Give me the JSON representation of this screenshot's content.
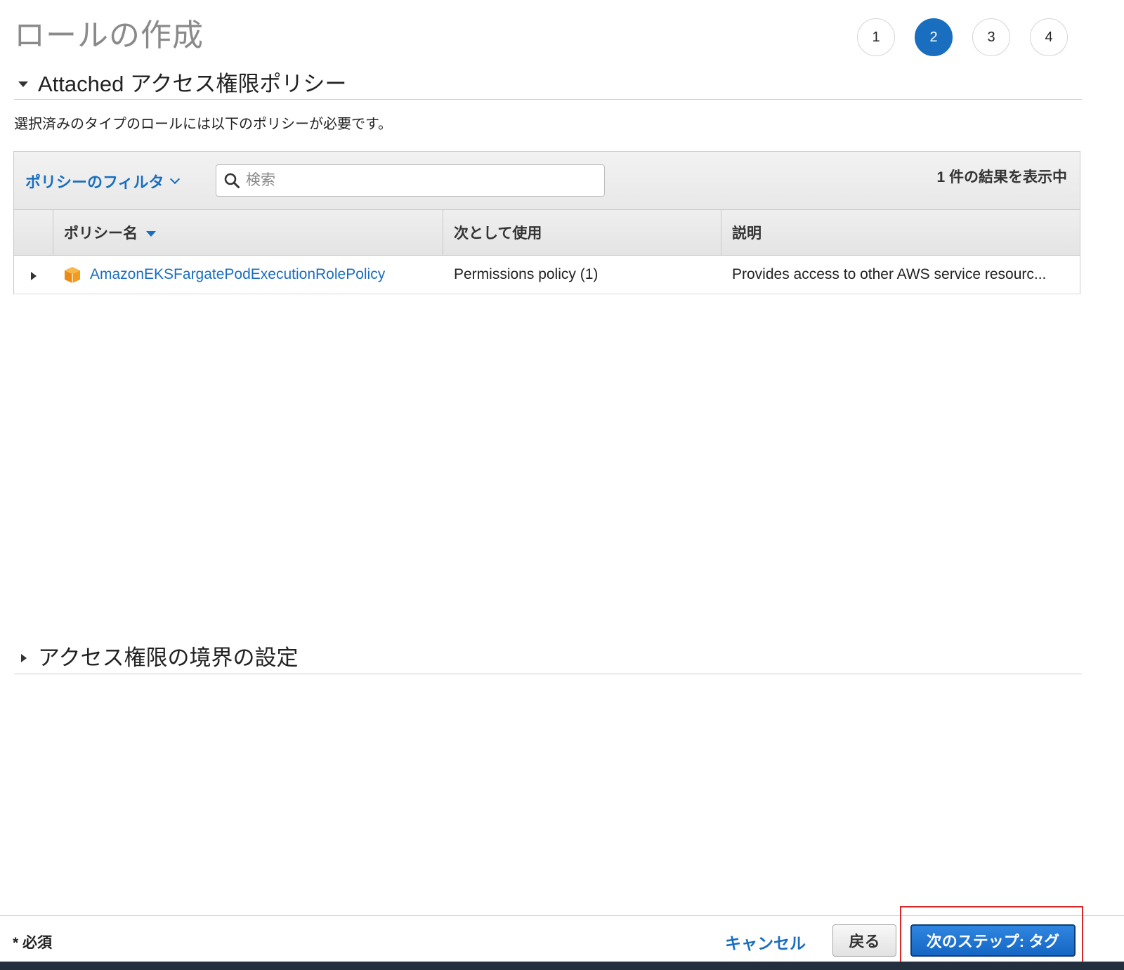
{
  "page": {
    "title": "ロールの作成"
  },
  "steps": [
    "1",
    "2",
    "3",
    "4"
  ],
  "active_step": "2",
  "attached_section": {
    "title": "Attached アクセス権限ポリシー",
    "description": "選択済みのタイプのロールには以下のポリシーが必要です。"
  },
  "toolbar": {
    "filter_label": "ポリシーのフィルタ",
    "search_placeholder": "検索",
    "result_count": "1 件の結果を表示中"
  },
  "table": {
    "columns": [
      "ポリシー名",
      "次として使用",
      "説明"
    ],
    "rows": [
      {
        "name": "AmazonEKSFargatePodExecutionRolePolicy",
        "used_as": "Permissions policy (1)",
        "description": "Provides access to other AWS service resourc..."
      }
    ]
  },
  "boundary_section": {
    "title": "アクセス権限の境界の設定"
  },
  "footer": {
    "required_note": "* 必須",
    "cancel_label": "キャンセル",
    "back_label": "戻る",
    "next_label": "次のステップ: タグ"
  },
  "colors": {
    "accent": "#1a6ec0",
    "highlight": "#d62a2a",
    "policy_icon": "#f29c1f"
  },
  "icons": {
    "search": "search-icon",
    "policy": "policy-box-icon"
  }
}
